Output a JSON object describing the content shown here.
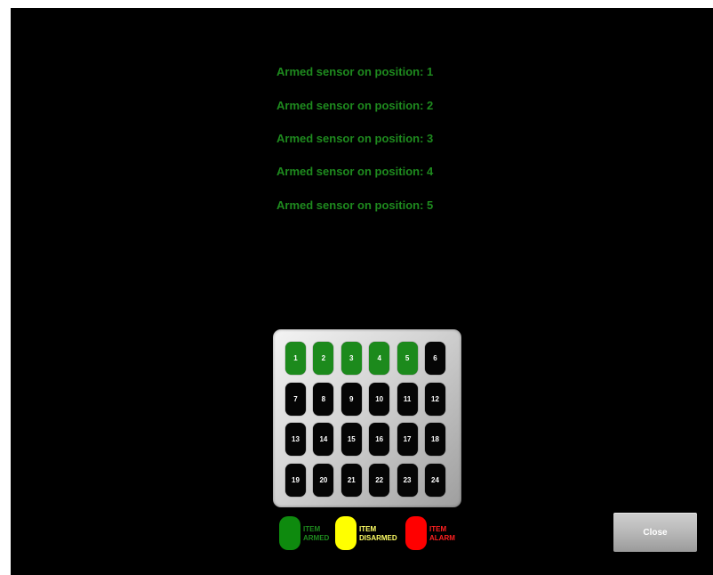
{
  "messages": [
    "Armed sensor on position: 1",
    "Armed sensor on position: 2",
    "Armed sensor on position: 3",
    "Armed sensor on position: 4",
    "Armed sensor on position: 5"
  ],
  "sensors": [
    {
      "label": "1",
      "state": "armed"
    },
    {
      "label": "2",
      "state": "armed"
    },
    {
      "label": "3",
      "state": "armed"
    },
    {
      "label": "4",
      "state": "armed"
    },
    {
      "label": "5",
      "state": "armed"
    },
    {
      "label": "6",
      "state": "idle"
    },
    {
      "label": "7",
      "state": "idle"
    },
    {
      "label": "8",
      "state": "idle"
    },
    {
      "label": "9",
      "state": "idle"
    },
    {
      "label": "10",
      "state": "idle"
    },
    {
      "label": "11",
      "state": "idle"
    },
    {
      "label": "12",
      "state": "idle"
    },
    {
      "label": "13",
      "state": "idle"
    },
    {
      "label": "14",
      "state": "idle"
    },
    {
      "label": "15",
      "state": "idle"
    },
    {
      "label": "16",
      "state": "idle"
    },
    {
      "label": "17",
      "state": "idle"
    },
    {
      "label": "18",
      "state": "idle"
    },
    {
      "label": "19",
      "state": "idle"
    },
    {
      "label": "20",
      "state": "idle"
    },
    {
      "label": "21",
      "state": "idle"
    },
    {
      "label": "22",
      "state": "idle"
    },
    {
      "label": "23",
      "state": "idle"
    },
    {
      "label": "24",
      "state": "idle"
    }
  ],
  "legend": [
    {
      "line1": "ITEM",
      "line2": "ARMED",
      "color": "#0e8a0e",
      "text_color": "#1e8a1e"
    },
    {
      "line1": "ITEM",
      "line2": "DISARMED",
      "color": "#ffff00",
      "text_color": "#ffff66"
    },
    {
      "line1": "ITEM",
      "line2": "ALARM",
      "color": "#ff0000",
      "text_color": "#ff2020"
    }
  ],
  "close_button": {
    "label": "Close"
  },
  "colors": {
    "background": "#000000",
    "armed": "#1c8a1c",
    "idle": "#050505",
    "message_text": "#1e8a1e"
  }
}
